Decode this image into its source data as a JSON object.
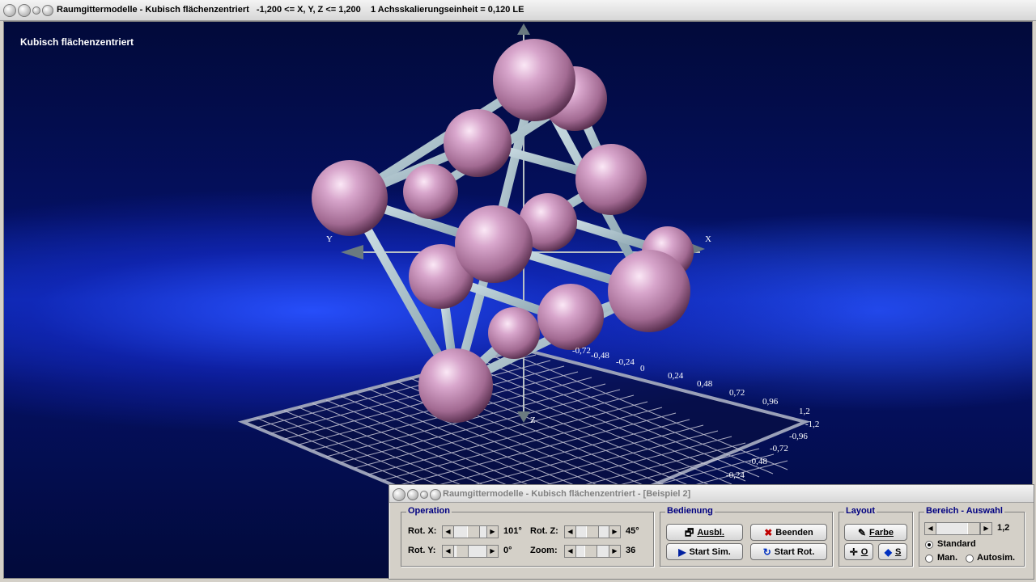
{
  "window": {
    "title": "Raumgittermodelle - Kubisch flächenzentriert   -1,200 <= X, Y, Z <= 1,200    1 Achsskalierungseinheit = 0,120 LE"
  },
  "scene": {
    "label": "Kubisch flächenzentriert",
    "axes": {
      "x": "X",
      "y": "Y",
      "z": "Z"
    },
    "ticks_right": [
      "-0,72",
      "-0,48",
      "-0,24",
      "0",
      "0,24",
      "0,48",
      "0,72",
      "0,96",
      "1,2"
    ],
    "ticks_front": [
      "-1,2",
      "-0,96",
      "-0,72",
      "-0,48",
      "-0,24"
    ],
    "colors": {
      "sphere": "#c890b8",
      "rod": "#a8c0c8",
      "grid": "#c8c8d8"
    }
  },
  "panel": {
    "title": "Raumgittermodelle - Kubisch flächenzentriert - [Beispiel 2]",
    "operation": {
      "legend": "Operation",
      "rot_x_label": "Rot. X:",
      "rot_x_value": "101°",
      "rot_y_label": "Rot. Y:",
      "rot_y_value": "0°",
      "rot_z_label": "Rot. Z:",
      "rot_z_value": "45°",
      "zoom_label": "Zoom:",
      "zoom_value": "36"
    },
    "bedienung": {
      "legend": "Bedienung",
      "ausbl": "Ausbl.",
      "beenden": "Beenden",
      "start_sim": "Start Sim.",
      "start_rot": "Start Rot."
    },
    "layout": {
      "legend": "Layout",
      "farbe": "Farbe",
      "o_btn": "O",
      "s_btn": "S"
    },
    "bereich": {
      "legend": "Bereich - Auswahl",
      "value": "1,2",
      "opt_standard": "Standard",
      "opt_man": "Man.",
      "opt_autosim": "Autosim.",
      "selected": "Standard"
    }
  }
}
